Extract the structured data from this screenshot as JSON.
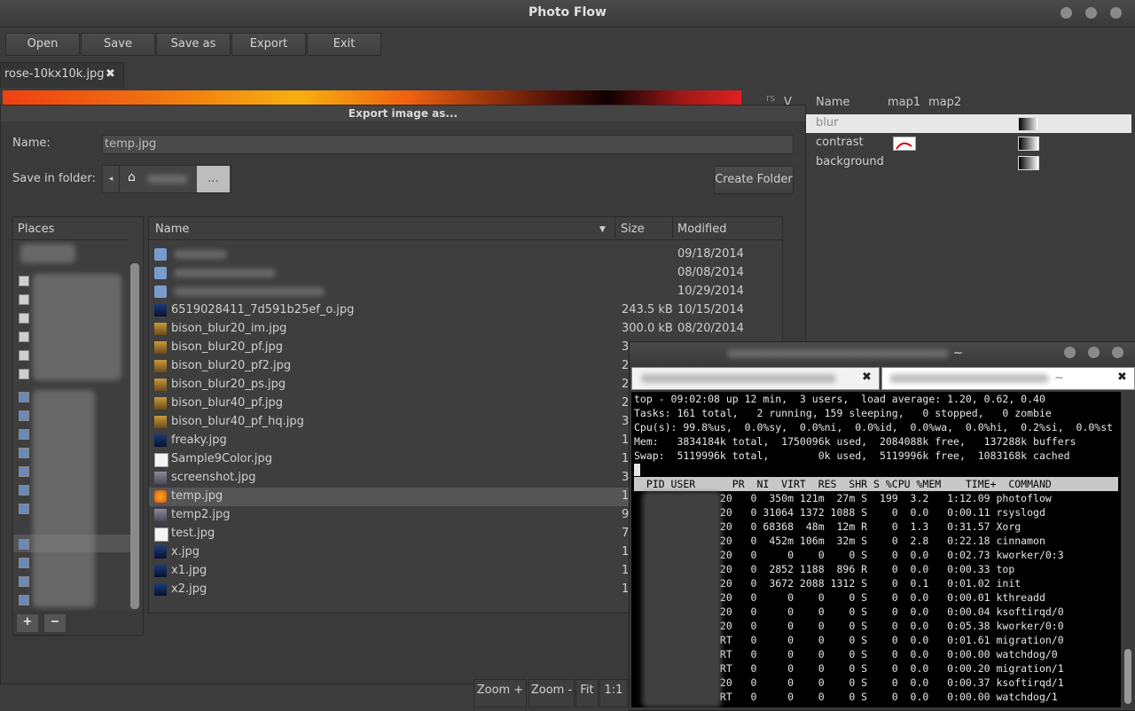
{
  "app": {
    "title": "Photo Flow"
  },
  "toolbar": [
    "Open",
    "Save",
    "Save as",
    "Export",
    "Exit"
  ],
  "image_tab": {
    "label": "rose-10kx10k.jpg",
    "close": "✖"
  },
  "layers": {
    "headers": [
      "Name",
      "map1",
      "map2"
    ],
    "rows": [
      "blur",
      "contrast",
      "background"
    ]
  },
  "dialog": {
    "title": "Export image as...",
    "name_label": "Name:",
    "name_value": "temp.jpg",
    "folder_label": "Save in folder:",
    "create_folder": "Create Folder",
    "path_more": "...",
    "places_header": "Places",
    "add_button": "+",
    "remove_button": "−",
    "columns": {
      "name": "Name",
      "size": "Size",
      "modified": "Modified"
    },
    "files": [
      {
        "name": "",
        "size": "",
        "date": "09/18/2014",
        "icon": "folder"
      },
      {
        "name": "",
        "size": "",
        "date": "08/08/2014",
        "icon": "folder"
      },
      {
        "name": "",
        "size": "",
        "date": "10/29/2014",
        "icon": "folder"
      },
      {
        "name": "6519028411_7d591b25ef_o.jpg",
        "size": "243.5 kB",
        "date": "10/15/2014",
        "icon": "image-dark"
      },
      {
        "name": "bison_blur20_im.jpg",
        "size": "300.0 kB",
        "date": "08/20/2014",
        "icon": "image-bison"
      },
      {
        "name": "bison_blur20_pf.jpg",
        "size": "3",
        "date": "",
        "icon": "image-bison"
      },
      {
        "name": "bison_blur20_pf2.jpg",
        "size": "2",
        "date": "",
        "icon": "image-bison"
      },
      {
        "name": "bison_blur20_ps.jpg",
        "size": "2",
        "date": "",
        "icon": "image-bison"
      },
      {
        "name": "bison_blur40_pf.jpg",
        "size": "2",
        "date": "",
        "icon": "image-bison"
      },
      {
        "name": "bison_blur40_pf_hq.jpg",
        "size": "3",
        "date": "",
        "icon": "image-bison"
      },
      {
        "name": "freaky.jpg",
        "size": "1",
        "date": "",
        "icon": "image-dark"
      },
      {
        "name": "Sample9Color.jpg",
        "size": "1",
        "date": "",
        "icon": "image-doc"
      },
      {
        "name": "screenshot.jpg",
        "size": "3",
        "date": "",
        "icon": "image-screen"
      },
      {
        "name": "temp.jpg",
        "size": "1",
        "date": "",
        "icon": "image-rose"
      },
      {
        "name": "temp2.jpg",
        "size": "9",
        "date": "",
        "icon": "image-screen"
      },
      {
        "name": "test.jpg",
        "size": "7",
        "date": "",
        "icon": "image-doc"
      },
      {
        "name": "x.jpg",
        "size": "1",
        "date": "",
        "icon": "image-dark"
      },
      {
        "name": "x1.jpg",
        "size": "1",
        "date": "",
        "icon": "image-dark"
      },
      {
        "name": "x2.jpg",
        "size": "1",
        "date": "",
        "icon": "image-dark"
      }
    ]
  },
  "zoom": [
    "Zoom +",
    "Zoom -",
    "Fit",
    "1:1"
  ],
  "terminal": {
    "title": "~",
    "tab2_label": "~",
    "tab_close": "✖",
    "lines": [
      "top - 09:02:08 up 12 min,  3 users,  load average: 1.20, 0.62, 0.40",
      "Tasks: 161 total,   2 running, 159 sleeping,   0 stopped,   0 zombie",
      "Cpu(s): 99.8%us,  0.0%sy,  0.0%ni,  0.0%id,  0.0%wa,  0.0%hi,  0.2%si,  0.0%st",
      "Mem:   3834184k total,  1750096k used,  2084088k free,   137288k buffers",
      "Swap:  5119996k total,        0k used,  5119996k free,  1083168k cached"
    ],
    "header": "  PID USER      PR  NI  VIRT  RES  SHR S %CPU %MEM    TIME+  COMMAND",
    "processes": [
      "              20   0  350m 121m  27m S  199  3.2   1:12.09 photoflow",
      "              20   0 31064 1372 1088 S    0  0.0   0:00.11 rsyslogd",
      "              20   0 68368  48m  12m R    0  1.3   0:31.57 Xorg",
      "              20   0  452m 106m  32m S    0  2.8   0:22.18 cinnamon",
      "              20   0     0    0    0 S    0  0.0   0:02.73 kworker/0:3",
      "              20   0  2852 1188  896 R    0  0.0   0:00.33 top",
      "              20   0  3672 2088 1312 S    0  0.1   0:01.02 init",
      "              20   0     0    0    0 S    0  0.0   0:00.01 kthreadd",
      "              20   0     0    0    0 S    0  0.0   0:00.04 ksoftirqd/0",
      "              20   0     0    0    0 S    0  0.0   0:05.38 kworker/0:0",
      "              RT   0     0    0    0 S    0  0.0   0:01.61 migration/0",
      "              RT   0     0    0    0 S    0  0.0   0:00.00 watchdog/0",
      "              RT   0     0    0    0 S    0  0.0   0:00.20 migration/1",
      "              20   0     0    0    0 S    0  0.0   0:00.37 ksoftirqd/1",
      "              RT   0     0    0    0 S    0  0.0   0:00.00 watchdog/1"
    ]
  }
}
